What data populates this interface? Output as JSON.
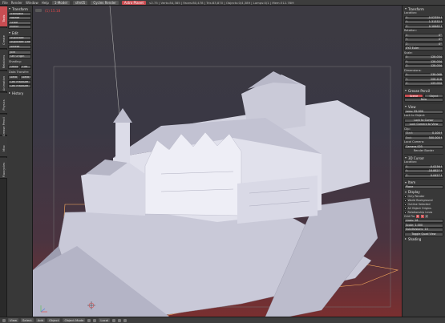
{
  "topbar": {
    "menus": [
      "File",
      "Render",
      "Window",
      "Help"
    ],
    "layout": "1-Model",
    "scene": "sfm05",
    "engine": "Cycles Render",
    "active_object": "Astro Planet",
    "stats": "v2.75 | Verts:84,385 | Faces:80,478 | Tris:83,870 | Objects:0/4,389 | Lamps:0/1 | Mem:312.78M"
  },
  "vtabs": [
    "Tools",
    "Create",
    "Relations",
    "Animation",
    "Physics",
    "Grease Pencil",
    "Misc",
    "Fluxcycles"
  ],
  "shelf": {
    "transform": {
      "title": "Transform",
      "buttons": [
        "Translate",
        "Rotate",
        "Scale",
        "Mirror"
      ]
    },
    "edit": {
      "title": "Edit",
      "buttons": [
        "Duplicate",
        "Duplicate Linked",
        "Delete",
        "Join"
      ],
      "origin": "Set Origin"
    },
    "shading": {
      "title": "Shading:",
      "smooth": "Smooth",
      "flat": "Flat"
    },
    "data_transfer": {
      "title": "Data Transfer:",
      "data": "Data",
      "data_lay": "Data Lay",
      "cell_fracture": "Cell Fracture",
      "cell_fracture2": "Cell Fracture"
    },
    "history": {
      "title": "History"
    }
  },
  "viewport": {
    "label": "(1) 15.18"
  },
  "props": {
    "transform_title": "Transform",
    "location_label": "Location:",
    "location": [
      {
        "k": "X:",
        "v": "-0.02359 f"
      },
      {
        "k": "Y:",
        "v": "1.31332 f"
      },
      {
        "k": "Z:",
        "v": "0.18462 f"
      }
    ],
    "rotation_label": "Rotation:",
    "rotation": [
      {
        "k": "X:",
        "v": "0°"
      },
      {
        "k": "Y:",
        "v": "0°"
      },
      {
        "k": "Z:",
        "v": "0°"
      }
    ],
    "rot_mode": "XYZ Euler",
    "scale_label": "Scale:",
    "scale": [
      {
        "k": "X:",
        "v": "128.034"
      },
      {
        "k": "Y:",
        "v": "128.034"
      },
      {
        "k": "Z:",
        "v": "128.034"
      }
    ],
    "dimensions_label": "Dimensions:",
    "dimensions": [
      {
        "k": "X:",
        "v": "238.068"
      },
      {
        "k": "Y:",
        "v": "208.418"
      },
      {
        "k": "Z:",
        "v": "129.054"
      }
    ],
    "grease_pencil": "Grease Pencil",
    "scene_tab": "Scene",
    "object_tab": "Object",
    "new_btn": "New",
    "view_title": "View",
    "lens": "Lens: 35.000",
    "lock_to_object": "Lock to Object:",
    "lock_cursor": "Lock to Cursor",
    "lock_camera": "Lock Camera to View",
    "clip_label": "Clip:",
    "clip_start": {
      "k": "Start:",
      "v": "0.100 f"
    },
    "clip_end": {
      "k": "End:",
      "v": "500.000 f"
    },
    "local_camera": "Local Camera:",
    "camera_name": "Camera.005",
    "render_border": "Render Border",
    "cursor_title": "3D Cursor",
    "cursor_location_label": "Location:",
    "cursor_location": [
      {
        "k": "X:",
        "v": "-0.0236 f"
      },
      {
        "k": "Y:",
        "v": "-18.8827 f"
      },
      {
        "k": "Z:",
        "v": "0.0427 f"
      }
    ],
    "item_title": "Item",
    "item_name": "Plane",
    "display_title": "Display",
    "display_opts": [
      "Only Render",
      "World Background",
      "Outline Selected",
      "All Object Origins",
      "Relationship Lines"
    ],
    "grid_floor": "Grid Flo",
    "grid_x": "X",
    "grid_y": "Y",
    "grid_z": "Z",
    "lines": "Lines: 16",
    "scale_field": "Scale: 1.000",
    "subdivisions": "Subdivisions: 10",
    "toggle_quad": "Toggle Quad View",
    "shading_title": "Shading"
  },
  "bottombar": {
    "view": "View",
    "select": "Select",
    "add": "Add",
    "object": "Object",
    "mode": "Object Mode",
    "pivot": "Local"
  }
}
